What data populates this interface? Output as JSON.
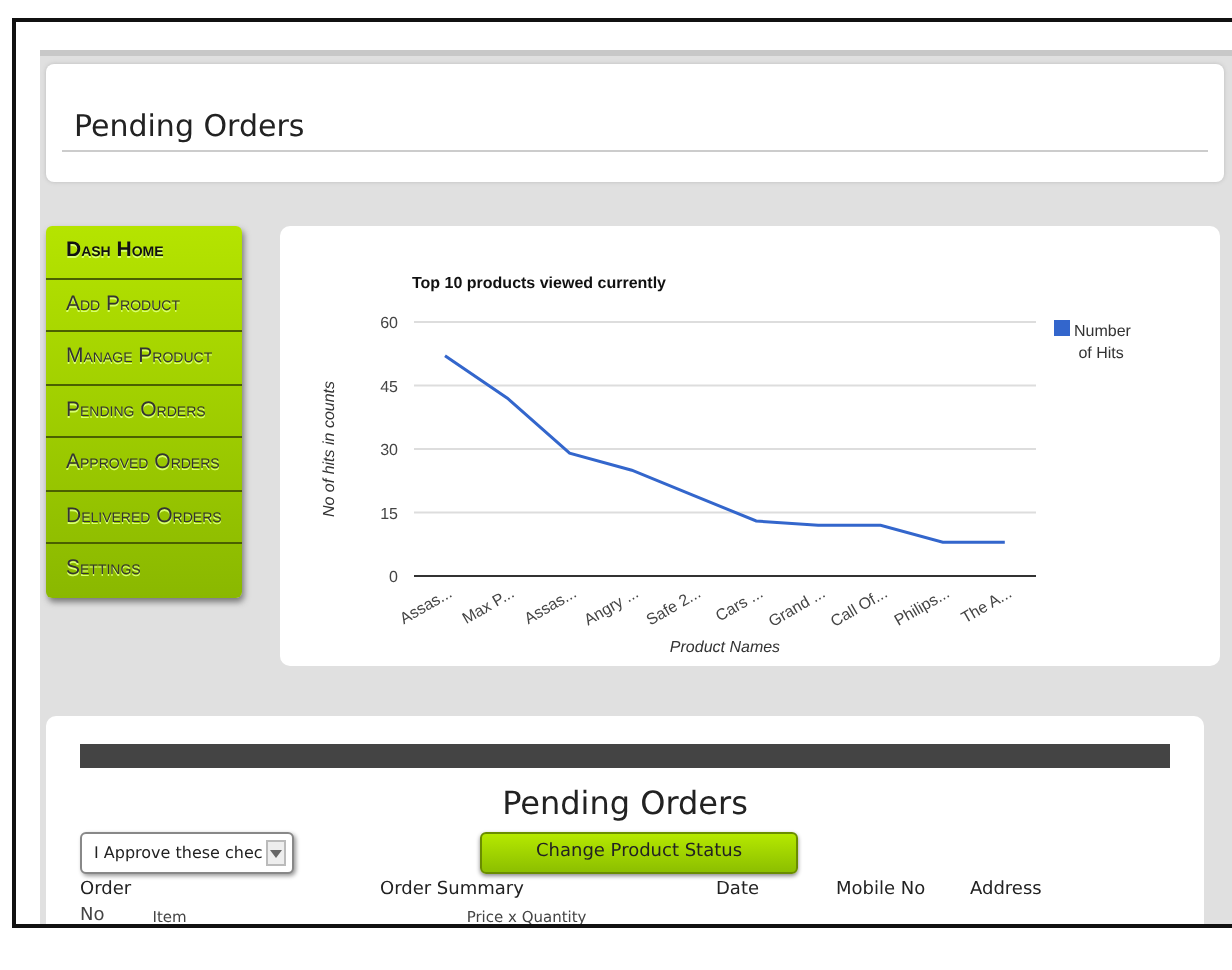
{
  "header": {
    "title": "Pending Orders"
  },
  "sidebar": {
    "items": [
      {
        "label": "Dash Home",
        "selected": true
      },
      {
        "label": "Add Product",
        "selected": false
      },
      {
        "label": "Manage Product",
        "selected": false
      },
      {
        "label": "Pending Orders",
        "selected": false
      },
      {
        "label": "Approved Orders",
        "selected": false
      },
      {
        "label": "Delivered Orders",
        "selected": false
      },
      {
        "label": "Settings",
        "selected": false
      }
    ]
  },
  "chart": {
    "chart_data": {
      "type": "line",
      "title": "Top 10 products viewed currently",
      "xlabel": "Product Names",
      "ylabel": "No of hits in counts",
      "categories": [
        "Assas...",
        "Max P...",
        "Assas...",
        "Angry ...",
        "Safe 2...",
        "Cars ...",
        "Grand ...",
        "Call Of...",
        "Philips...",
        "The A..."
      ],
      "series": [
        {
          "name": "Number of Hits",
          "color": "#3366cc",
          "values": [
            52,
            42,
            29,
            25,
            19,
            13,
            12,
            12,
            8,
            8
          ]
        }
      ],
      "ylim": [
        0,
        60
      ],
      "grid": true,
      "yticks": [
        0,
        15,
        30,
        45,
        60
      ]
    }
  },
  "orders": {
    "title": "Pending Orders",
    "approve_select": {
      "value": "I Approve these chec"
    },
    "status_button": "Change Product Status",
    "columns": [
      {
        "label": "Order"
      },
      {
        "label": "Order Summary"
      },
      {
        "label": "Date"
      },
      {
        "label": "Mobile No"
      },
      {
        "label": "Address"
      }
    ],
    "subcolumns": [
      {
        "label": "No"
      },
      {
        "label": "Item"
      },
      {
        "label": "Price x Quantity"
      }
    ]
  }
}
